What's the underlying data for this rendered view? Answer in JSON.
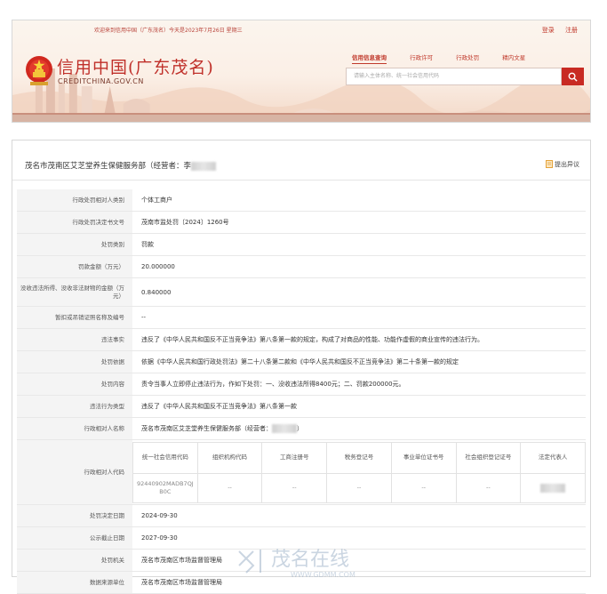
{
  "header": {
    "welcome": "欢迎来到信用中国（广东茂名）今天是2023年7月26日 星期三",
    "login": "登录",
    "register": "注册",
    "logo_title": "信用中国(广东茂名)",
    "logo_url": "CREDITCHINA.GOV.CN",
    "nav": [
      "信用信息查询",
      "行政许可",
      "行政处罚",
      "精内文星"
    ],
    "search_placeholder": "请输入主体名称、统一社会信用代码"
  },
  "record": {
    "title": "茂名市茂南区艾芝堂养生保健服务部（经营者：李",
    "objection_label": "提出异议",
    "rows": {
      "object_type": {
        "label": "行政处罚相对人类别",
        "value": "个体工商户"
      },
      "decision_no": {
        "label": "行政处罚决定书文号",
        "value": "茂南市监处罚〔2024〕1260号"
      },
      "penalty_type": {
        "label": "处罚类别",
        "value": "罚款"
      },
      "fine": {
        "label": "罚款金额（万元）",
        "value": "20.000000"
      },
      "confiscation": {
        "label": "没收违法所得、没收非法财物的金额（万元）",
        "value": "0.840000"
      },
      "license_info": {
        "label": "暂扣或吊销证照名称及编号",
        "value": "--"
      },
      "violation_facts": {
        "label": "违法事实",
        "value": "违反了《中华人民共和国反不正当竞争法》第八条第一款的规定，构成了对商品的性能、功能作虚假的商业宣传的违法行为。"
      },
      "penalty_basis": {
        "label": "处罚依据",
        "value": "依据《中华人民共和国行政处罚法》第二十八条第二款和《中华人民共和国反不正当竞争法》第二十条第一款的规定"
      },
      "penalty_content": {
        "label": "处罚内容",
        "value": "责令当事人立即停止违法行为，作如下处罚：一、没收违法所得8400元；二、罚款200000元。"
      },
      "violation_type": {
        "label": "违法行为类型",
        "value": "违反了《中华人民共和国反不正当竞争法》第八条第一款"
      },
      "object_name": {
        "label": "行政相对人名称",
        "value": "茂名市茂南区艾芝堂养生保健服务部（经营者："
      },
      "object_code": {
        "label": "行政相对人代码"
      },
      "decision_date": {
        "label": "处罚决定日期",
        "value": "2024-09-30"
      },
      "publish_deadline": {
        "label": "公示截止日期",
        "value": "2027-09-30"
      },
      "authority": {
        "label": "处罚机关",
        "value": "茂名市茂南区市场监督管理局"
      },
      "data_source": {
        "label": "数据来源单位",
        "value": "茂名市茂南区市场监督管理局"
      }
    },
    "code_table": {
      "headers": [
        "统一社会信用代码",
        "组织机构代码",
        "工商注册号",
        "税务登记号",
        "事业单位证书号",
        "社会组织登记证号",
        "法定代表人"
      ],
      "values": [
        "92440902MADB7QJB0C",
        "--",
        "--",
        "--",
        "--",
        "--",
        ""
      ]
    }
  },
  "watermark": {
    "brand": "茂名在线",
    "url": "WWW.GDMM.COM"
  },
  "colors": {
    "brand_red": "#c82a23",
    "label_bg": "#f4f4f4",
    "border": "#e8e8e8"
  }
}
